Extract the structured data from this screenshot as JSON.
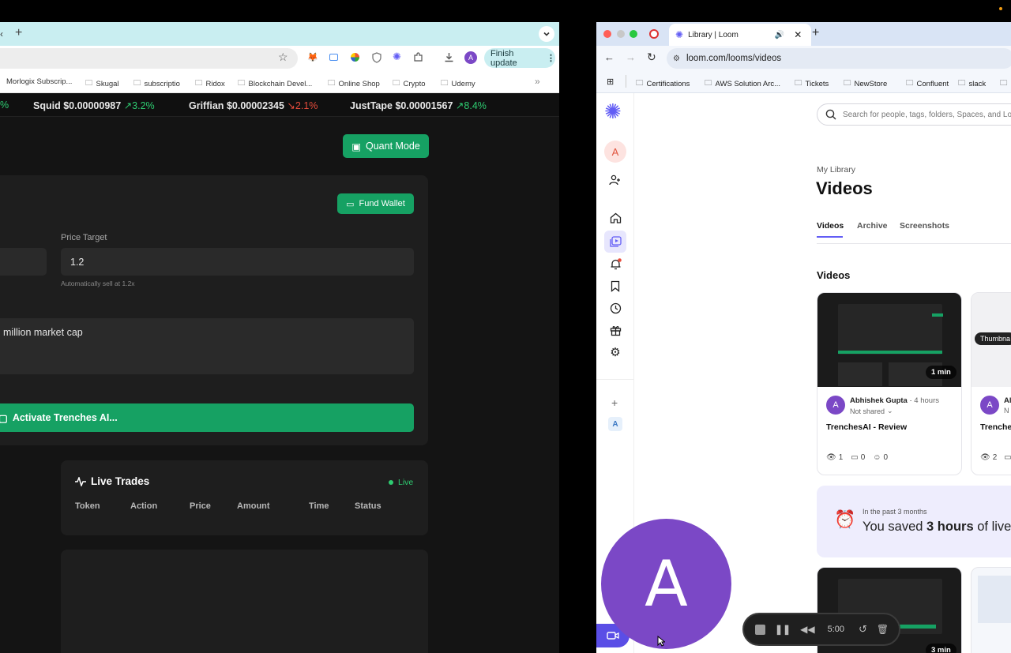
{
  "left": {
    "tab_new": "+",
    "finish_update": "Finish update",
    "bookmarks": [
      "Morlogix Subscrip...",
      "Skugal",
      "subscriptio",
      "Ridox",
      "Blockchain Devel...",
      "Online Shop",
      "Crypto",
      "Udemy"
    ],
    "ticker": [
      {
        "name": "Squid",
        "price": "$0.00000987",
        "change": "3.2%",
        "dir": "up"
      },
      {
        "name": "Griffian",
        "price": "$0.00002345",
        "change": "2.1%",
        "dir": "down"
      },
      {
        "name": "JustTape",
        "price": "$0.00001567",
        "change": "8.4%",
        "dir": "up"
      }
    ],
    "ticker_lead": "%",
    "quant_mode": "Quant Mode",
    "fund_wallet": "Fund Wallet",
    "price_target_label": "Price Target",
    "price_target_value": "1.2",
    "price_target_hint": "Automatically sell at 1.2x",
    "strategy_text": "million market cap",
    "activate": "Activate Trenches AI...",
    "live_trades_title": "Live Trades",
    "live_label": "Live",
    "table_headers": [
      "Token",
      "Action",
      "Price",
      "Amount",
      "Time",
      "Status"
    ]
  },
  "right": {
    "tab_title": "Library | Loom",
    "url": "loom.com/looms/videos",
    "bookmarks": [
      "Certifications",
      "AWS Solution Arc...",
      "Tickets",
      "NewStore",
      "Confluent",
      "slack"
    ],
    "search_placeholder": "Search for people, tags, folders, Spaces, and Lo",
    "avatar_letter": "A",
    "breadcrumb": "My Library",
    "title": "Videos",
    "tabs": [
      "Videos",
      "Archive",
      "Screenshots"
    ],
    "section": "Videos",
    "card1": {
      "duration": "1 min",
      "author": "Abhishek Gupta",
      "time": "4 hours",
      "sharing": "Not shared",
      "title": "TrenchesAI - Review",
      "views": "1",
      "comments": "0",
      "reactions": "0"
    },
    "card2": {
      "thumb_label": "Thumbna",
      "author": "Al",
      "sharing": "N",
      "title": "Trenche",
      "views": "2"
    },
    "saved": {
      "period": "In the past 3 months",
      "prefix": "You saved ",
      "hours": "3 hours",
      "suffix": " of live"
    },
    "card3_duration": "3 min",
    "sidebar_plus": "+",
    "sidebar_ws": "A"
  },
  "overlay": {
    "avatar_letter": "A",
    "timer": "5:00"
  },
  "colors": {
    "accent_green": "#16a163",
    "loom_purple": "#625df5",
    "avatar_purple": "#7b48c6"
  }
}
